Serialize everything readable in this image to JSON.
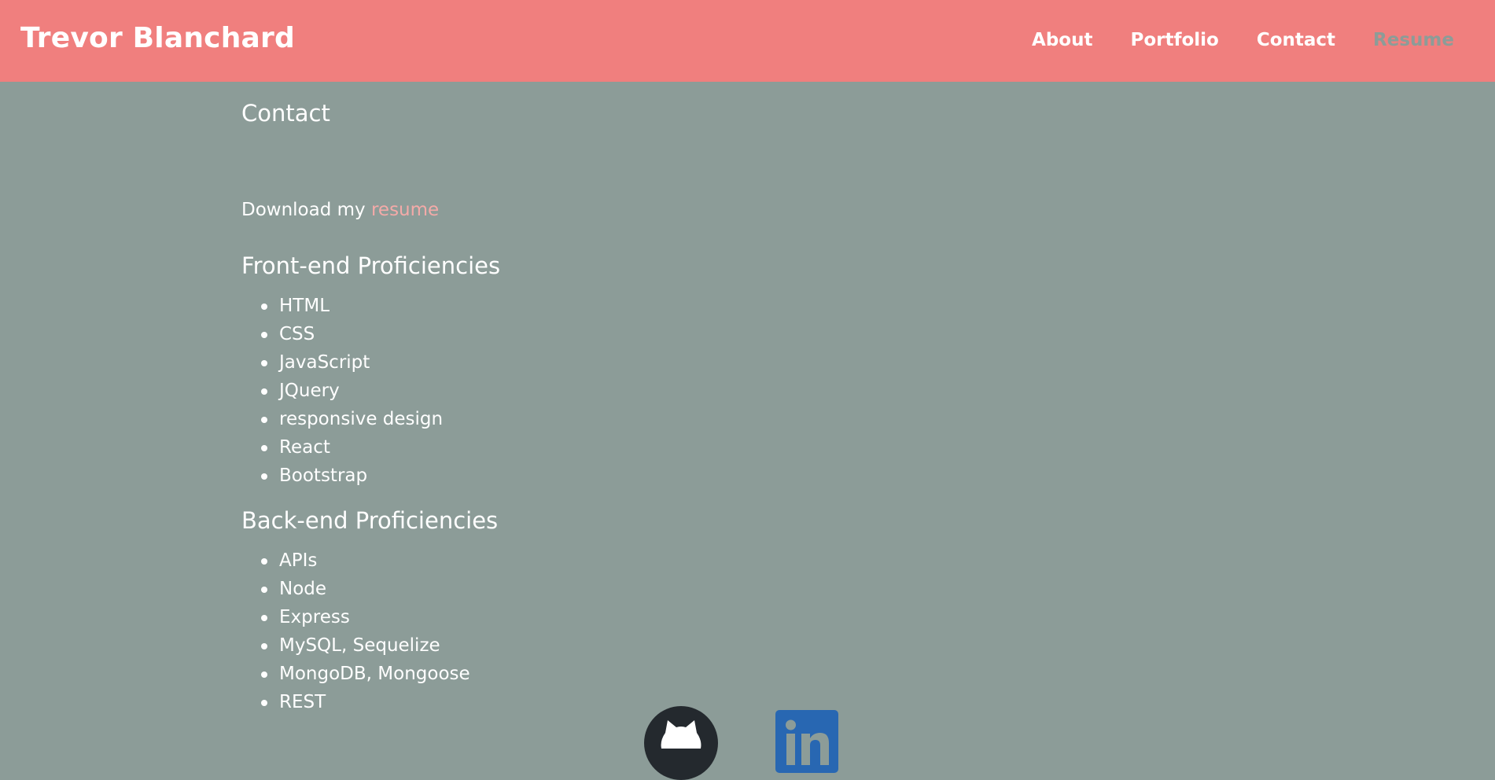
{
  "header": {
    "brand": "Trevor Blanchard",
    "nav": [
      {
        "label": "About"
      },
      {
        "label": "Portfolio"
      },
      {
        "label": "Contact"
      },
      {
        "label": "Resume",
        "active": true
      }
    ]
  },
  "main": {
    "title": "Contact",
    "resume_prefix": "Download my",
    "resume_link": "resume",
    "frontend": {
      "heading": "Front-end Proficiencies",
      "items": [
        "HTML",
        "CSS",
        "JavaScript",
        "JQuery",
        "responsive design",
        "React",
        "Bootstrap"
      ]
    },
    "backend": {
      "heading": "Back-end Proficiencies",
      "items": [
        "APIs",
        "Node",
        "Express",
        "MySQL, Sequelize",
        "MongoDB, Mongoose",
        "REST"
      ]
    }
  },
  "social": {
    "github_icon": "github-icon",
    "linkedin_icon": "linkedin-icon"
  },
  "colors": {
    "header_bg": "#f07f7e",
    "page_bg": "#8c9c98",
    "link": "#f4aaa8",
    "text": "#ffffff"
  }
}
